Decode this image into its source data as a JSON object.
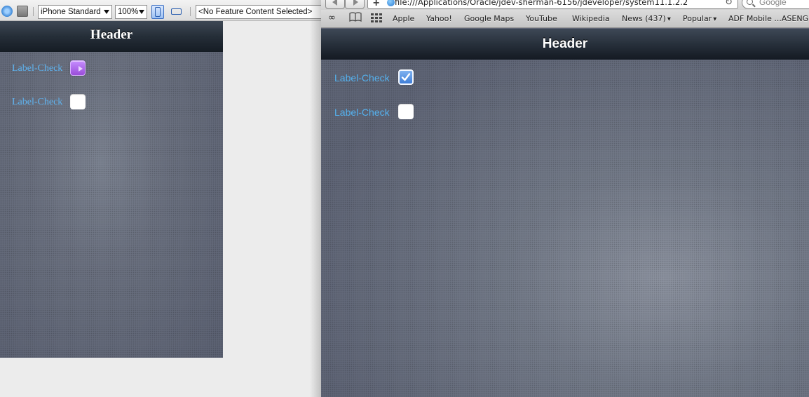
{
  "left_pane": {
    "toolbar": {
      "device_select": "iPhone Standard",
      "zoom_select": "100%",
      "feature_select": "<No Feature Content Selected>"
    },
    "header_title": "Header",
    "rows": [
      {
        "label": "Label-Check",
        "checked": true
      },
      {
        "label": "Label-Check",
        "checked": false
      }
    ]
  },
  "browser": {
    "url": "file:///Applications/Oracle/jdev-sherman-6156/jdeveloper/system11.1.2.2",
    "search_placeholder": "Google",
    "bookmarks": [
      "Apple",
      "Yahoo!",
      "Google Maps",
      "YouTube",
      "Wikipedia",
      "News (437)",
      "Popular",
      "ADF Mobile ...ASENG"
    ],
    "header_title": "Header",
    "rows": [
      {
        "label": "Label-Check",
        "checked": true
      },
      {
        "label": "Label-Check",
        "checked": false
      }
    ]
  },
  "colors": {
    "label_blue": "#5fb3ef",
    "left_checked_purple": "#9a4dd9",
    "right_checked_blue": "#3f7ed8"
  }
}
